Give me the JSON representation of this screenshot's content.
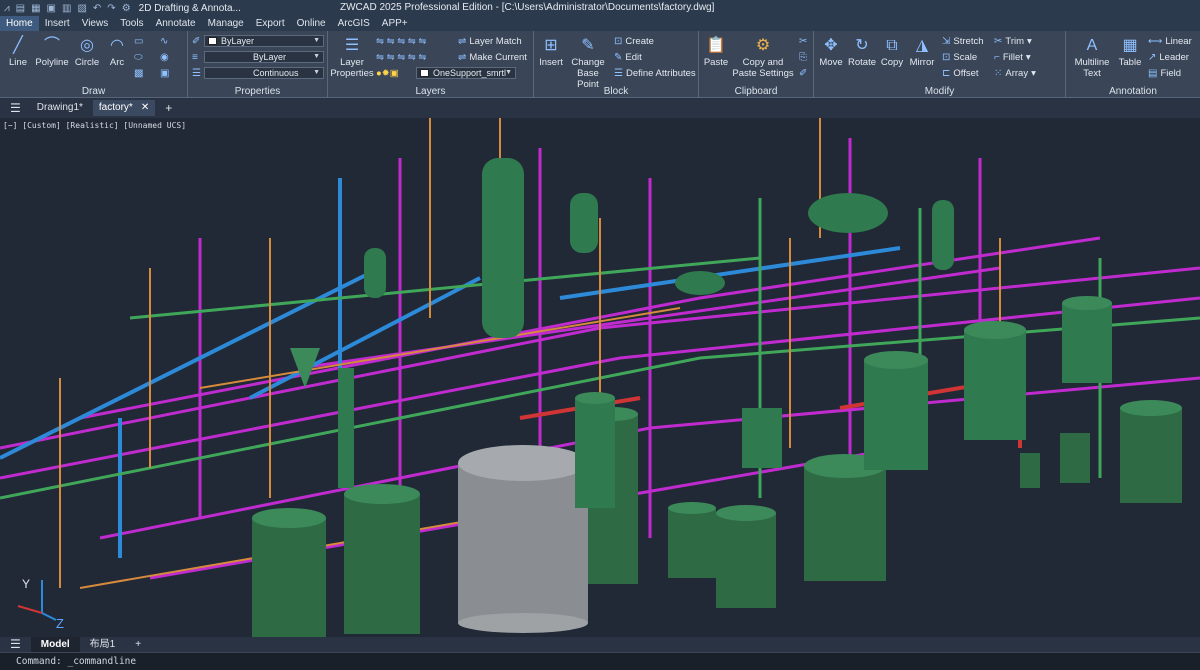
{
  "title_bar": {
    "workspace": "2D Drafting & Annota...",
    "title": "ZWCAD 2025 Professional Edition - [C:\\Users\\Administrator\\Documents\\factory.dwg]"
  },
  "menu": [
    "Home",
    "Insert",
    "Views",
    "Tools",
    "Annotate",
    "Manage",
    "Export",
    "Online",
    "ArcGIS",
    "APP+"
  ],
  "ribbon": {
    "draw": {
      "label": "Draw",
      "line": "Line",
      "polyline": "Polyline",
      "circle": "Circle",
      "arc": "Arc"
    },
    "properties": {
      "label": "Properties",
      "color": "ByLayer",
      "linetype": "ByLayer",
      "lineweight": "Continuous"
    },
    "layers": {
      "label": "Layers",
      "layer_properties": "Layer Properties",
      "layer_match": "Layer Match",
      "make_current": "Make Current",
      "current_layer": "OneSupport_smrtl"
    },
    "block": {
      "label": "Block",
      "insert": "Insert",
      "change_base": "Change Base Point",
      "create": "Create",
      "edit": "Edit",
      "define_attr": "Define Attributes"
    },
    "clipboard": {
      "label": "Clipboard",
      "paste": "Paste",
      "copy_paste_settings": "Copy and Paste Settings"
    },
    "modify": {
      "label": "Modify",
      "move": "Move",
      "rotate": "Rotate",
      "copy": "Copy",
      "mirror": "Mirror",
      "stretch": "Stretch",
      "scale": "Scale",
      "offset": "Offset",
      "trim": "Trim",
      "fillet": "Fillet",
      "array": "Array"
    },
    "annotation": {
      "label": "Annotation",
      "mtext": "Multiline Text",
      "table": "Table",
      "linear": "Linear",
      "leader": "Leader",
      "field": "Field"
    }
  },
  "doc_tabs": [
    "Drawing1*",
    "factory*"
  ],
  "viewport_label": "[−] [Custom] [Realistic] [Unnamed UCS]",
  "axis": {
    "y": "Y",
    "z": "Z"
  },
  "layout_tabs": [
    "Model",
    "布局1"
  ],
  "command_line": "Command: _commandline",
  "colors": {
    "magenta": "#c02bd0",
    "green": "#2f7a4e",
    "blue": "#2d8ad8",
    "orange": "#d58a3c",
    "tank": "#2e6b44"
  }
}
